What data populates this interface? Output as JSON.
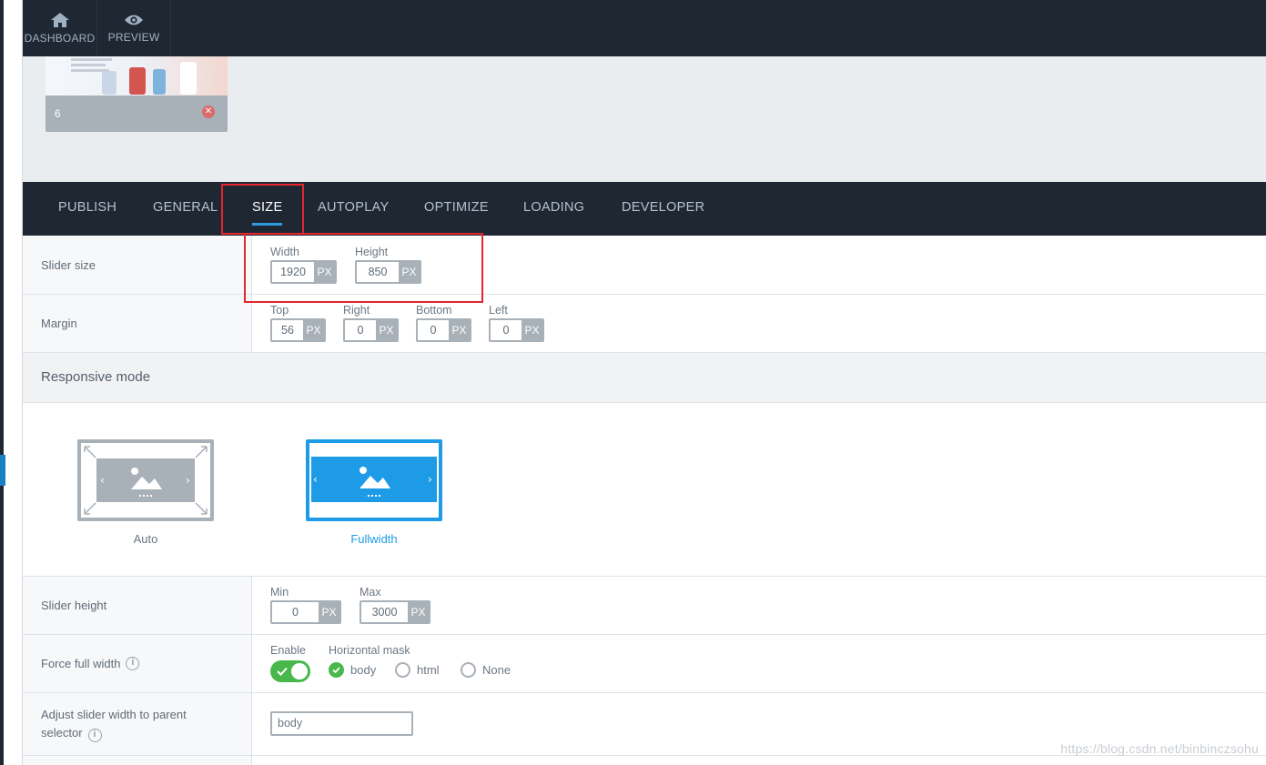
{
  "topbar": {
    "dashboard_label": "DASHBOARD",
    "preview_label": "PREVIEW"
  },
  "slide": {
    "number": "6"
  },
  "tabs": [
    {
      "label": "PUBLISH"
    },
    {
      "label": "GENERAL"
    },
    {
      "label": "SIZE"
    },
    {
      "label": "AUTOPLAY"
    },
    {
      "label": "OPTIMIZE"
    },
    {
      "label": "LOADING"
    },
    {
      "label": "DEVELOPER"
    }
  ],
  "unit": "PX",
  "slider_size": {
    "label": "Slider size",
    "width_label": "Width",
    "width_value": "1920",
    "height_label": "Height",
    "height_value": "850"
  },
  "margin": {
    "label": "Margin",
    "top_label": "Top",
    "top_value": "56",
    "right_label": "Right",
    "right_value": "0",
    "bottom_label": "Bottom",
    "bottom_value": "0",
    "left_label": "Left",
    "left_value": "0"
  },
  "responsive": {
    "section_title": "Responsive mode",
    "auto_label": "Auto",
    "fullwidth_label": "Fullwidth"
  },
  "slider_height": {
    "label": "Slider height",
    "min_label": "Min",
    "min_value": "0",
    "max_label": "Max",
    "max_value": "3000"
  },
  "force_full_width": {
    "label": "Force full width",
    "enable_label": "Enable",
    "mask_label": "Horizontal mask",
    "options": [
      "body",
      "html",
      "None"
    ]
  },
  "adjust_width": {
    "label_line1": "Adjust slider width to parent",
    "label_line2": "selector",
    "value": "body"
  },
  "watermark": "https://blog.csdn.net/binbinczsohu",
  "colors": {
    "dark_bar": "#1e2732",
    "accent_blue": "#1d9be6",
    "toggle_green": "#48b84c",
    "highlight_red": "#e5262d"
  }
}
